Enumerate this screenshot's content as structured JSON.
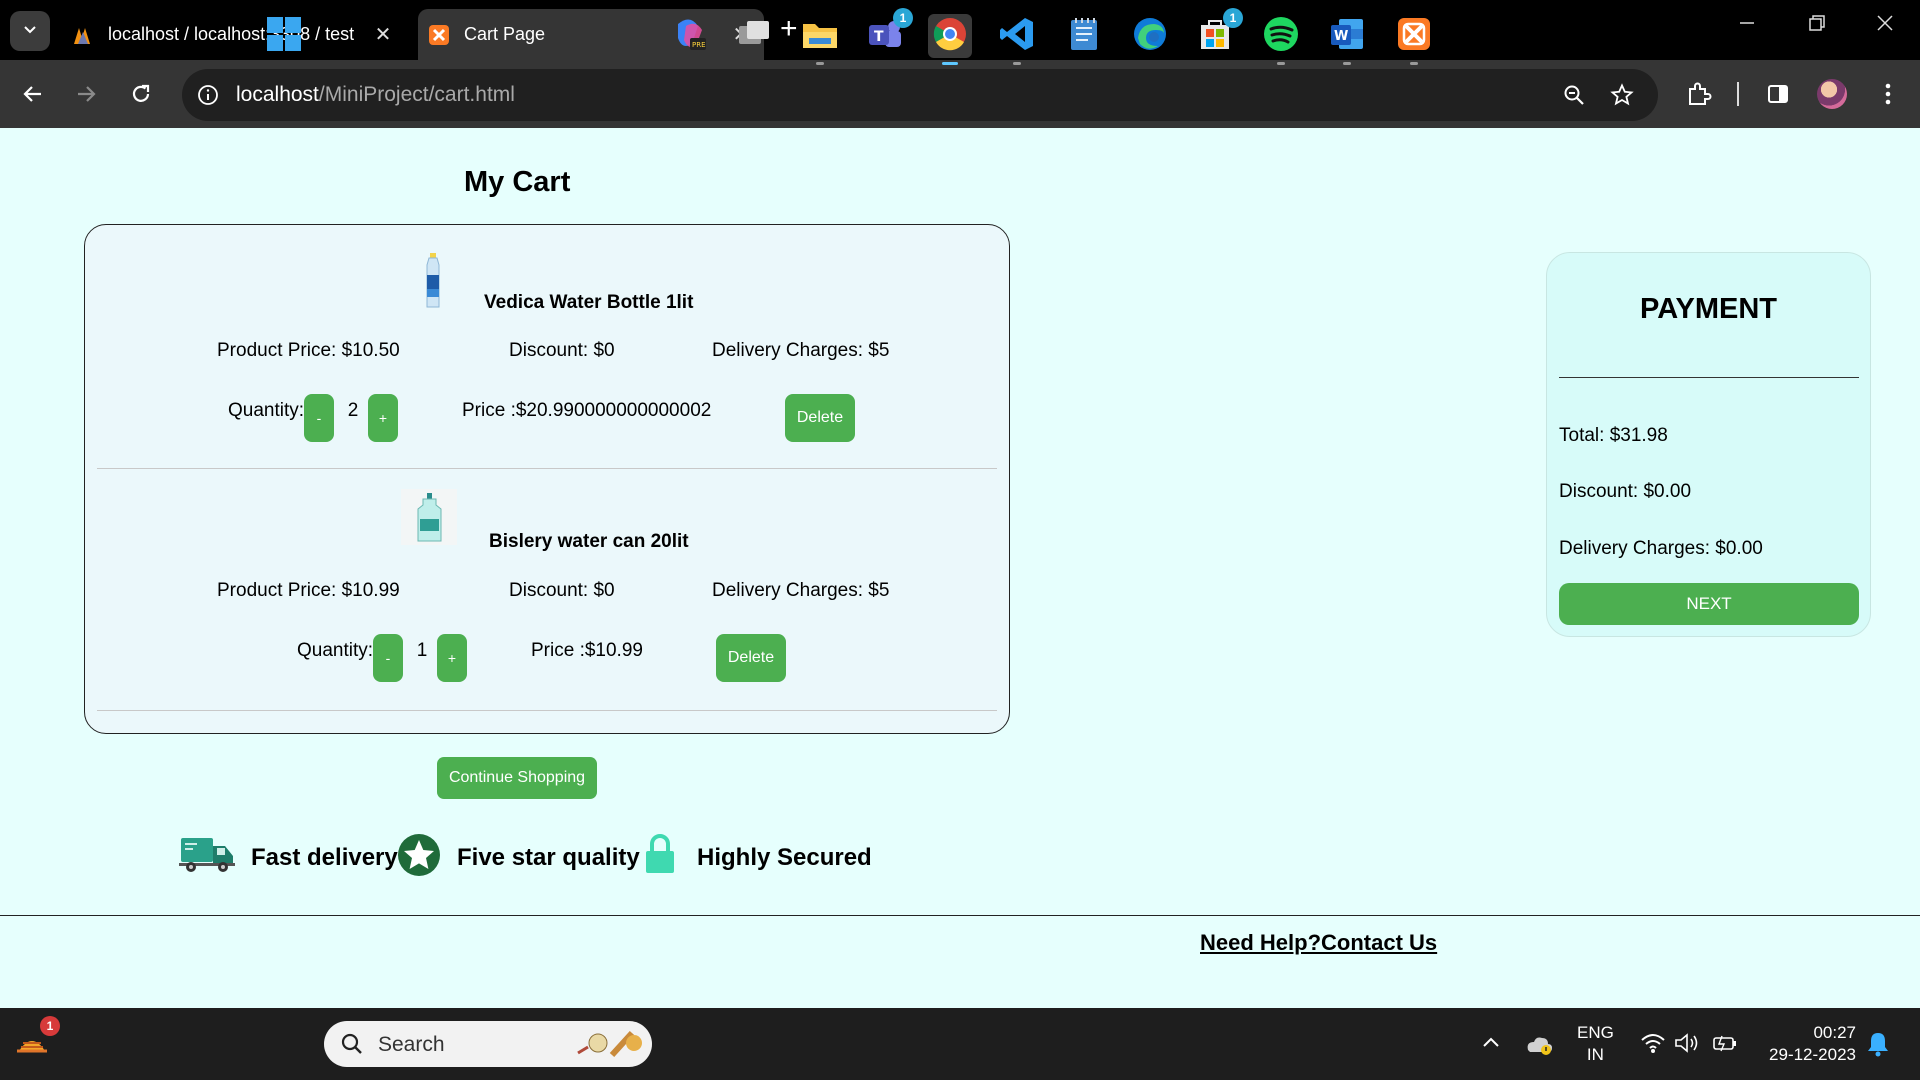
{
  "browser": {
    "tabs": [
      {
        "title": "localhost / localhost:3308 / test",
        "close": "✕"
      },
      {
        "title": "Cart Page",
        "close": "✕"
      }
    ],
    "new_tab": "+",
    "url_host": "localhost",
    "url_path": "/MiniProject/cart.html"
  },
  "cart": {
    "title": "My Cart",
    "items": [
      {
        "name": "Vedica Water Bottle 1lit",
        "product_price": "Product Price: $10.50",
        "discount": "Discount: $0",
        "delivery": "Delivery Charges: $5",
        "quantity_label": "Quantity:",
        "minus": "-",
        "quantity": "2",
        "plus": "+",
        "price": "Price :$20.990000000000002",
        "delete": "Delete"
      },
      {
        "name": "Bislery water can 20lit",
        "product_price": "Product Price: $10.99",
        "discount": "Discount: $0",
        "delivery": "Delivery Charges: $5",
        "quantity_label": "Quantity:",
        "minus": "-",
        "quantity": "1",
        "plus": "+",
        "price": "Price :$10.99",
        "delete": "Delete"
      }
    ],
    "continue_label": "Continue Shopping"
  },
  "features": [
    {
      "icon": "truck-icon",
      "label": "Fast delivery"
    },
    {
      "icon": "star-icon",
      "label": "Five star quality"
    },
    {
      "icon": "lock-icon",
      "label": "Highly Secured"
    }
  ],
  "payment": {
    "title": "PAYMENT",
    "total": "Total: $31.98",
    "discount": "Discount: $0.00",
    "delivery": "Delivery Charges: $0.00",
    "next_label": "NEXT"
  },
  "footer": {
    "help_link": "Need Help?Contact Us"
  },
  "taskbar": {
    "search_placeholder": "Search",
    "widgets_badge": "1",
    "teams_badge": "1",
    "store_badge": "1",
    "lang_line1": "ENG",
    "lang_line2": "IN",
    "time": "00:27",
    "date": "29-12-2023"
  },
  "colors": {
    "page_bg": "#e6fffd",
    "accent_green": "#4caf50",
    "payment_bg": "#d7fbf9",
    "cart_bg": "#ebf8fb"
  }
}
